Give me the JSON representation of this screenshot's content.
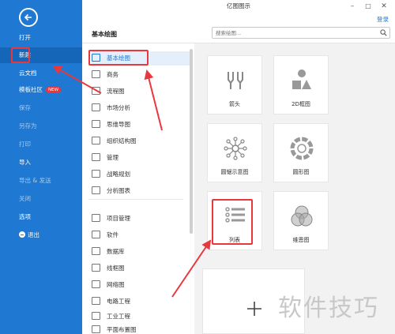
{
  "window": {
    "title": "亿图图示",
    "login": "登录"
  },
  "sidebar": {
    "items": [
      {
        "label": "打开"
      },
      {
        "label": "新建"
      },
      {
        "label": "云文档"
      },
      {
        "label": "模板社区",
        "badge": "NEW"
      },
      {
        "label": "保存"
      },
      {
        "label": "另存为"
      },
      {
        "label": "打印"
      },
      {
        "label": "导入"
      },
      {
        "label": "导出 & 发送"
      },
      {
        "label": "关闭"
      },
      {
        "label": "选项"
      },
      {
        "label": "退出"
      }
    ]
  },
  "header": {
    "title": "基本绘图",
    "search_placeholder": "搜索绘图..."
  },
  "categories": [
    {
      "label": "基本绘图"
    },
    {
      "label": "商务"
    },
    {
      "label": "流程图"
    },
    {
      "label": "市场分析"
    },
    {
      "label": "思维导图"
    },
    {
      "label": "组织结构图"
    },
    {
      "label": "管理"
    },
    {
      "label": "战略规划"
    },
    {
      "label": "分析图表"
    },
    {
      "label": "项目管理"
    },
    {
      "label": "软件"
    },
    {
      "label": "数据库"
    },
    {
      "label": "线框图"
    },
    {
      "label": "网络图"
    },
    {
      "label": "电路工程"
    },
    {
      "label": "工业工程"
    },
    {
      "label": "平面布置图"
    }
  ],
  "templates": [
    {
      "label": "箭头"
    },
    {
      "label": "2D框图"
    },
    {
      "label": "圆锯示意图"
    },
    {
      "label": "圆形图"
    },
    {
      "label": "列表"
    },
    {
      "label": "维恩图"
    }
  ],
  "watermark": "软件技巧",
  "colors": {
    "sidebar": "#1f78d1",
    "accent": "#1f78d1",
    "annotation": "#e8383d"
  }
}
